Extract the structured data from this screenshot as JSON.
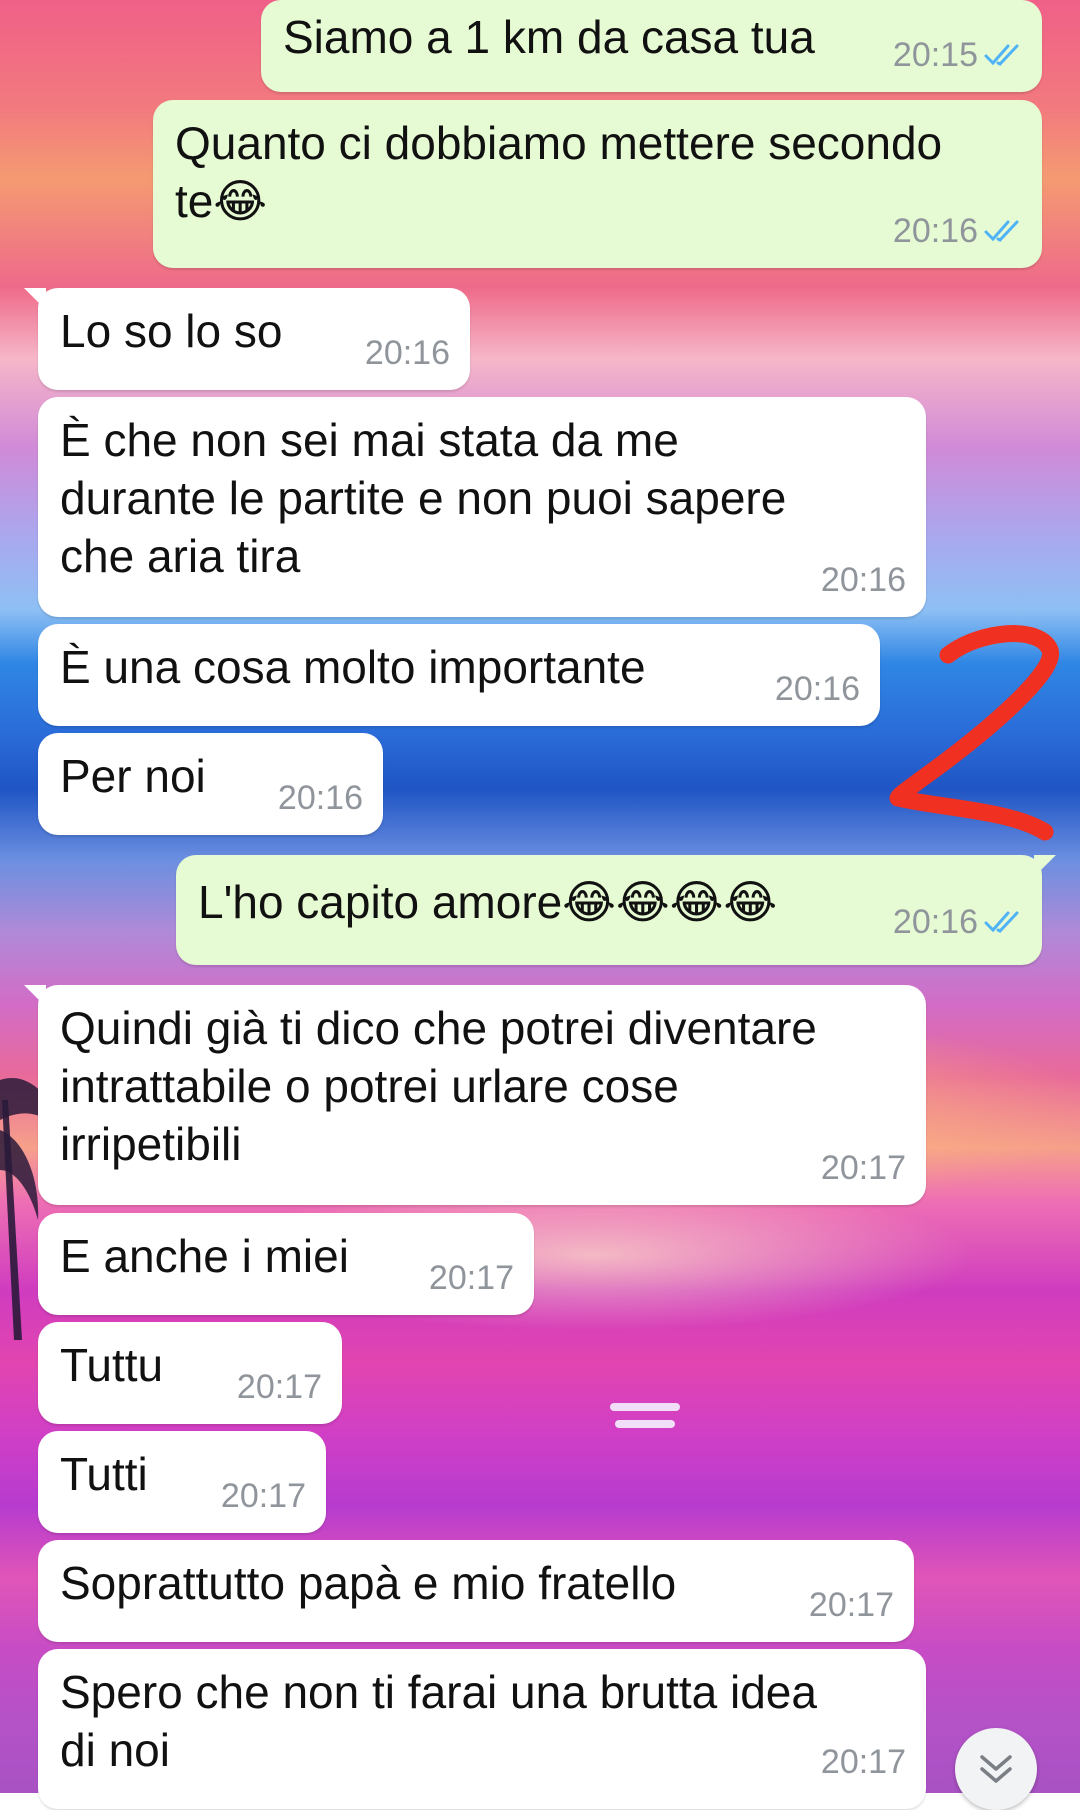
{
  "messages": [
    {
      "dir": "out",
      "text": "Siamo a 1 km da casa tua",
      "time": "20:15",
      "read": true
    },
    {
      "dir": "out",
      "text": "Quanto ci dobbiamo mettere secondo\nte😂",
      "time": "20:16",
      "read": true
    },
    {
      "dir": "in",
      "text": "Lo so lo so",
      "time": "20:16"
    },
    {
      "dir": "in",
      "text": "È che non sei mai stata da me\ndurante le partite e non puoi sapere\nche aria tira",
      "time": "20:16"
    },
    {
      "dir": "in",
      "text": "È una cosa molto importante",
      "time": "20:16"
    },
    {
      "dir": "in",
      "text": "Per noi",
      "time": "20:16"
    },
    {
      "dir": "out",
      "text": "L'ho capito amore😂😂😂😂",
      "time": "20:16",
      "read": true
    },
    {
      "dir": "in",
      "text": "Quindi già ti dico che potrei diventare\nintrattabile o potrei urlare cose\nirripetibili",
      "time": "20:17"
    },
    {
      "dir": "in",
      "text": "E anche i miei",
      "time": "20:17"
    },
    {
      "dir": "in",
      "text": "Tuttu",
      "time": "20:17"
    },
    {
      "dir": "in",
      "text": "Tutti",
      "time": "20:17"
    },
    {
      "dir": "in",
      "text": "Soprattutto papà e mio fratello",
      "time": "20:17"
    },
    {
      "dir": "in",
      "text": "Spero che non ti farai una brutta idea\ndi noi",
      "time": "20:17"
    }
  ],
  "icons": {
    "read_receipt": "double-check-icon",
    "emoji": "face-with-tears-of-joy",
    "scroll": "chevron-double-down-icon",
    "annotation": "red-handwritten-number"
  },
  "colors": {
    "incoming_bubble": "#ffffff",
    "outgoing_bubble": "#e6fbd3",
    "timestamp": "#8f959b",
    "read_tick": "#4fb3f6",
    "annotation": "#f03020"
  }
}
